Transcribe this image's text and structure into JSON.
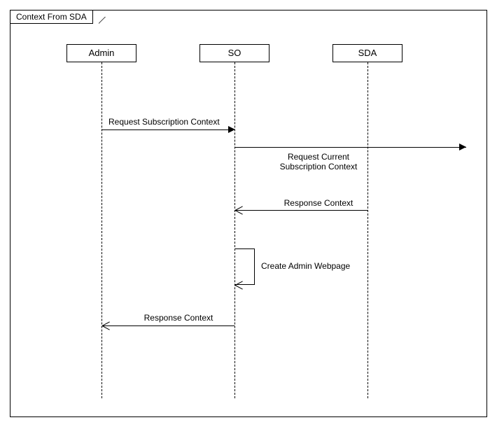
{
  "frame": {
    "title": "Context From SDA"
  },
  "lifelines": {
    "admin": {
      "label": "Admin"
    },
    "so": {
      "label": "SO"
    },
    "sda": {
      "label": "SDA"
    }
  },
  "messages": {
    "m1": {
      "label": "Request Subscription Context"
    },
    "m2": {
      "label": "Request Current\nSubscription Context"
    },
    "m3": {
      "label": "Response Context"
    },
    "m4": {
      "label": "Create Admin Webpage"
    },
    "m5": {
      "label": "Response Context"
    }
  },
  "chart_data": {
    "type": "sequence-diagram",
    "frame": "Context From SDA",
    "participants": [
      "Admin",
      "SO",
      "SDA"
    ],
    "interactions": [
      {
        "from": "Admin",
        "to": "SO",
        "label": "Request Subscription Context",
        "kind": "call"
      },
      {
        "from": "SO",
        "to": "SDA",
        "label": "Request Current Subscription Context",
        "kind": "call"
      },
      {
        "from": "SDA",
        "to": "SO",
        "label": "Response Context",
        "kind": "return"
      },
      {
        "from": "SO",
        "to": "SO",
        "label": "Create Admin Webpage",
        "kind": "self"
      },
      {
        "from": "SO",
        "to": "Admin",
        "label": "Response Context",
        "kind": "return"
      }
    ]
  }
}
